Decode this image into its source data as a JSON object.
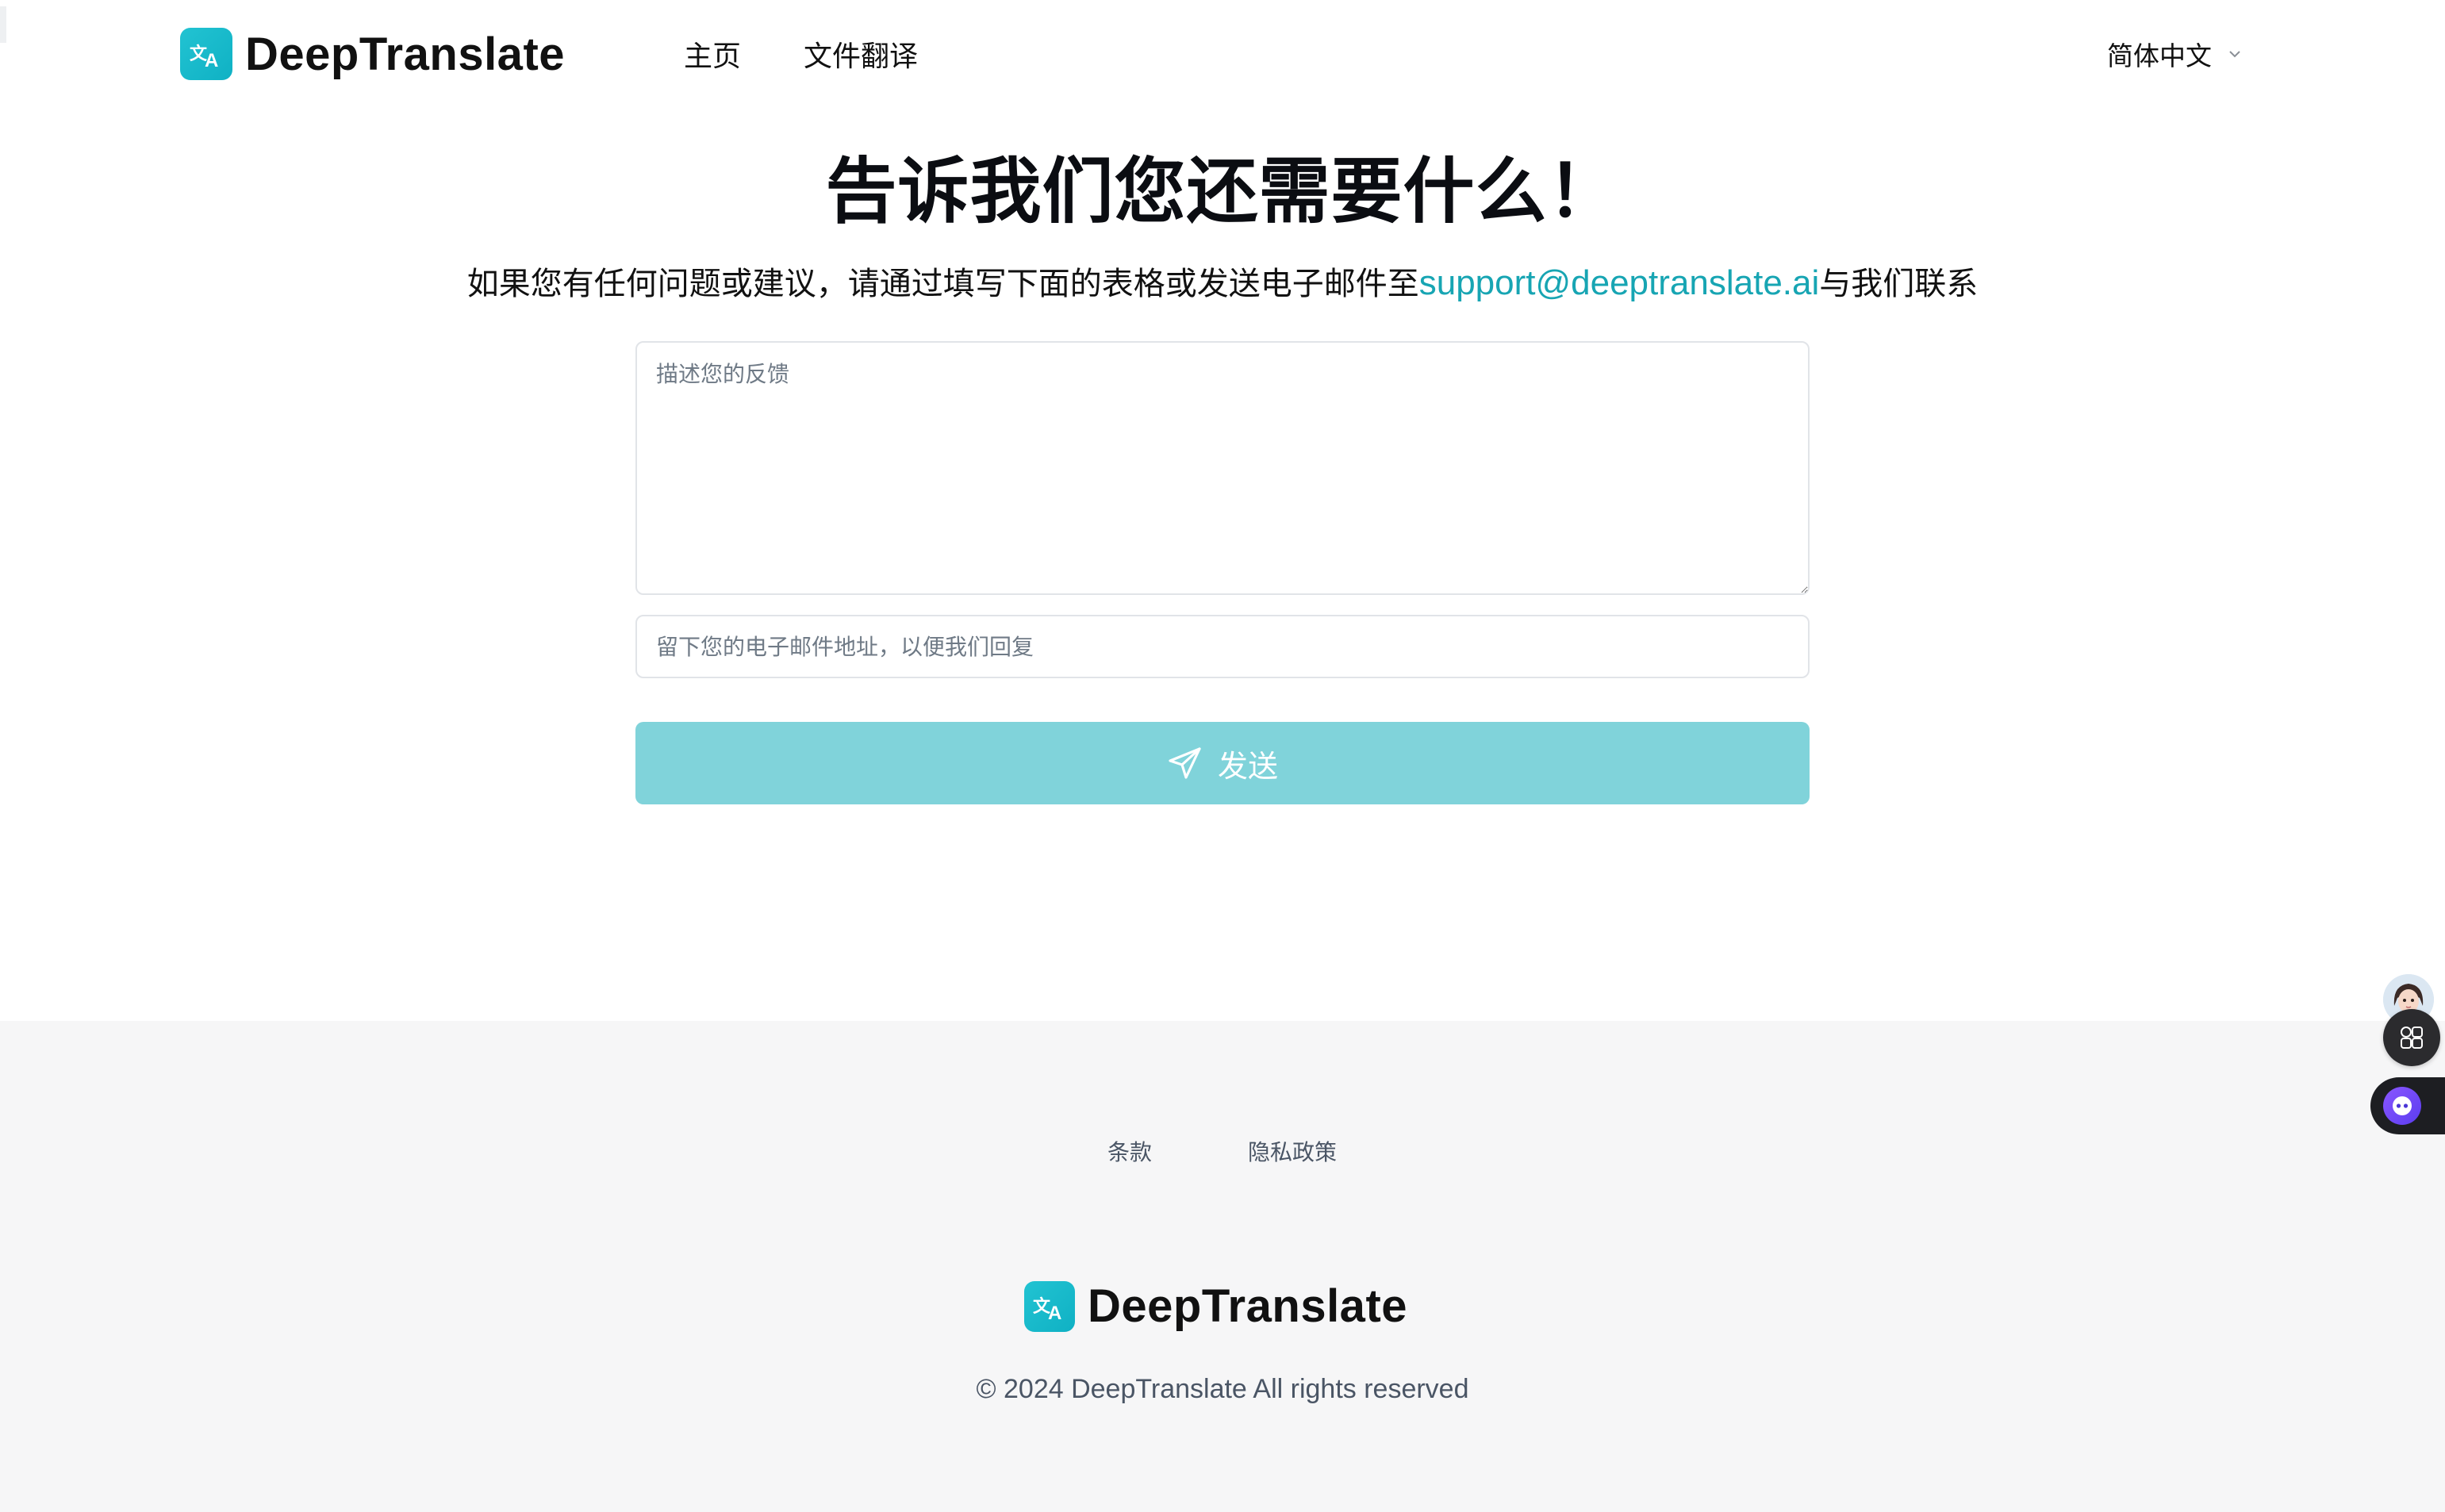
{
  "header": {
    "brand": "DeepTranslate",
    "nav": {
      "home": "主页",
      "file_translate": "文件翻译"
    },
    "language": "简体中文"
  },
  "main": {
    "title": "告诉我们您还需要什么！",
    "subtitle_before": "如果您有任何问题或建议，请通过填写下面的表格或发送电子邮件至",
    "support_email": "support@deeptranslate.ai",
    "subtitle_after": "与我们联系",
    "feedback_placeholder": "描述您的反馈",
    "email_placeholder": "留下您的电子邮件地址，以便我们回复",
    "send_label": "发送"
  },
  "footer": {
    "terms": "条款",
    "privacy": "隐私政策",
    "brand": "DeepTranslate",
    "copyright": "© 2024 DeepTranslate All rights reserved"
  },
  "colors": {
    "brand": "#15b8c8",
    "send_button": "#80d3da",
    "link": "#17a5b3",
    "footer_bg": "#f6f6f7"
  },
  "icons": [
    "translate-logo-icon",
    "chevron-down-icon",
    "send-icon",
    "apps-grid-icon",
    "assistant-bot-icon",
    "avatar"
  ]
}
